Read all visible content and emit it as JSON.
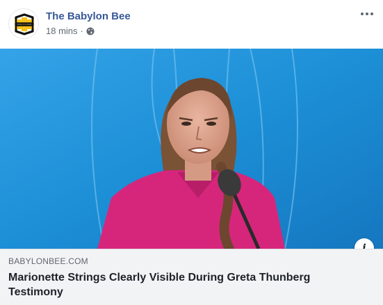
{
  "post": {
    "page_name": "The Babylon Bee",
    "timestamp": "18 mins",
    "separator": "·",
    "privacy_icon": "globe-icon",
    "options_icon": "more-options-icon"
  },
  "link_preview": {
    "domain": "BABYLONBEE.COM",
    "title": "Marionette Strings Clearly Visible During Greta Thunberg Testimony",
    "info_icon": "info-icon",
    "info_label": "i"
  },
  "colors": {
    "page_name": "#385898",
    "image_background": "#1c8fd6",
    "link_box": "#f2f3f5",
    "shirt": "#d6267c"
  }
}
